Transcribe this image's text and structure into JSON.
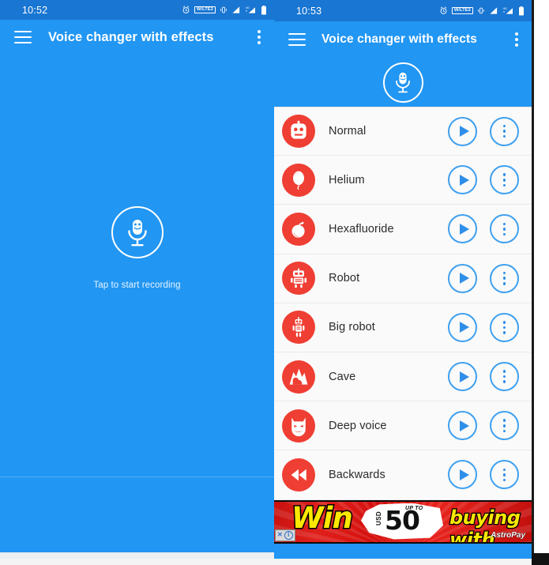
{
  "left_panel": {
    "status_bar": {
      "time": "10:52",
      "icons": [
        "alarm-icon",
        "volte-badge",
        "vibrate-icon",
        "signal-bars-icon",
        "signal-4g-icon",
        "battery-icon"
      ],
      "volte_label": "W/LTE2",
      "background": "#1976D2"
    },
    "app_bar": {
      "menu_icon": "hamburger-icon",
      "title": "Voice changer with effects",
      "overflow_icon": "kebab-menu-icon",
      "background": "#2196F3"
    },
    "body": {
      "mic_icon": "microphone-face-icon",
      "hint": "Tap to start recording",
      "background": "#2196F3"
    }
  },
  "right_panel": {
    "status_bar": {
      "time": "10:53",
      "icons": [
        "alarm-icon",
        "volte-badge",
        "vibrate-icon",
        "signal-bars-icon",
        "signal-4g-icon",
        "battery-icon"
      ],
      "volte_label": "W/LTE2",
      "background": "#1976D2"
    },
    "app_bar": {
      "menu_icon": "hamburger-icon",
      "title": "Voice changer with effects",
      "overflow_icon": "kebab-menu-icon",
      "background": "#2196F3"
    },
    "mic_band": {
      "mic_icon": "microphone-face-icon"
    },
    "effects": [
      {
        "name": "Normal",
        "icon": "robot-face-icon",
        "play": "play-icon",
        "more": "kebab-menu-icon"
      },
      {
        "name": "Helium",
        "icon": "balloon-icon",
        "play": "play-icon",
        "more": "kebab-menu-icon"
      },
      {
        "name": "Hexafluoride",
        "icon": "bomb-icon",
        "play": "play-icon",
        "more": "kebab-menu-icon"
      },
      {
        "name": "Robot",
        "icon": "robot-body-icon",
        "play": "play-icon",
        "more": "kebab-menu-icon"
      },
      {
        "name": "Big robot",
        "icon": "big-robot-icon",
        "play": "play-icon",
        "more": "kebab-menu-icon"
      },
      {
        "name": "Cave",
        "icon": "cave-icon",
        "play": "play-icon",
        "more": "kebab-menu-icon"
      },
      {
        "name": "Deep voice",
        "icon": "devil-mask-icon",
        "play": "play-icon",
        "more": "kebab-menu-icon"
      },
      {
        "name": "Backwards",
        "icon": "rewind-icon",
        "play": "play-icon",
        "more": "kebab-menu-icon"
      }
    ],
    "colors": {
      "avatar": "#EF3E33",
      "button_outline": "#3EA0F0",
      "list_background": "#FAFAFA"
    },
    "ad": {
      "word_win": "Win",
      "up_to": "UP TO",
      "currency": "USD",
      "amount": "50",
      "tagline": "buying with",
      "brand": "AstroPay",
      "close_label": "✕",
      "info_label": "i"
    }
  }
}
